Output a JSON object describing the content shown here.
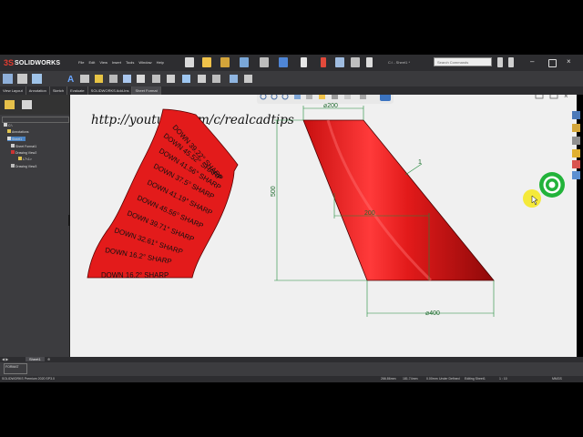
{
  "app": {
    "logo_text": "SOLIDWORKS",
    "document_title": "C:\\ - Sheet1 *",
    "menus": [
      "File",
      "Edit",
      "View",
      "Insert",
      "Tools",
      "Window",
      "Help"
    ],
    "search_placeholder": "Search Commands"
  },
  "command_tabs": [
    "View Layout",
    "Annotation",
    "Sketch",
    "Evaluate",
    "SOLIDWORKS Add-Ins",
    "Sheet Format"
  ],
  "feature_tree": {
    "root": "C:\\",
    "items": [
      "Annotations",
      "Sheet1",
      "Sheet Format1",
      "Drawing View2",
      "L7<1>",
      "Drawing View3"
    ]
  },
  "canvas": {
    "url_text": "http://youtube.com/c/realcadtips",
    "flat_pattern_labels": [
      "DOWN  16.2° SHARP",
      "DOWN  39.22° SHARP",
      "DOWN  45.52° SHARP",
      "DOWN  41.56° SHARP",
      "DOWN  37.5° SHARP",
      "DOWN  41.19° SHARP",
      "DOWN  45.56° SHARP",
      "DOWN  39.71° SHARP",
      "DOWN  32.61° SHARP",
      "DOWN  16.2° SHARP"
    ],
    "dim_top": "⌀200",
    "dim_height": "500",
    "dim_bottom": "⌀400",
    "dim_thickness": "1",
    "dim_center": "200"
  },
  "sheet_tab": "Sheet1",
  "bottom_panel_label": "FORMAT",
  "status": {
    "product": "SOLIDWORKS Premium 2020 SP3.0",
    "coord1": "266.86mm",
    "coord2": "181.74mm",
    "coord3": "0.00mm",
    "state": "Under Defined",
    "editing": "Editing Sheet1",
    "scale": "1 : 10",
    "units": "MMGS"
  },
  "colors": {
    "part_red": "#e31b1b",
    "part_red_dark": "#8e0909",
    "dim_green": "#1f8a3a",
    "target_green": "#22b33a",
    "cursor_yellow": "#f6e81a"
  }
}
